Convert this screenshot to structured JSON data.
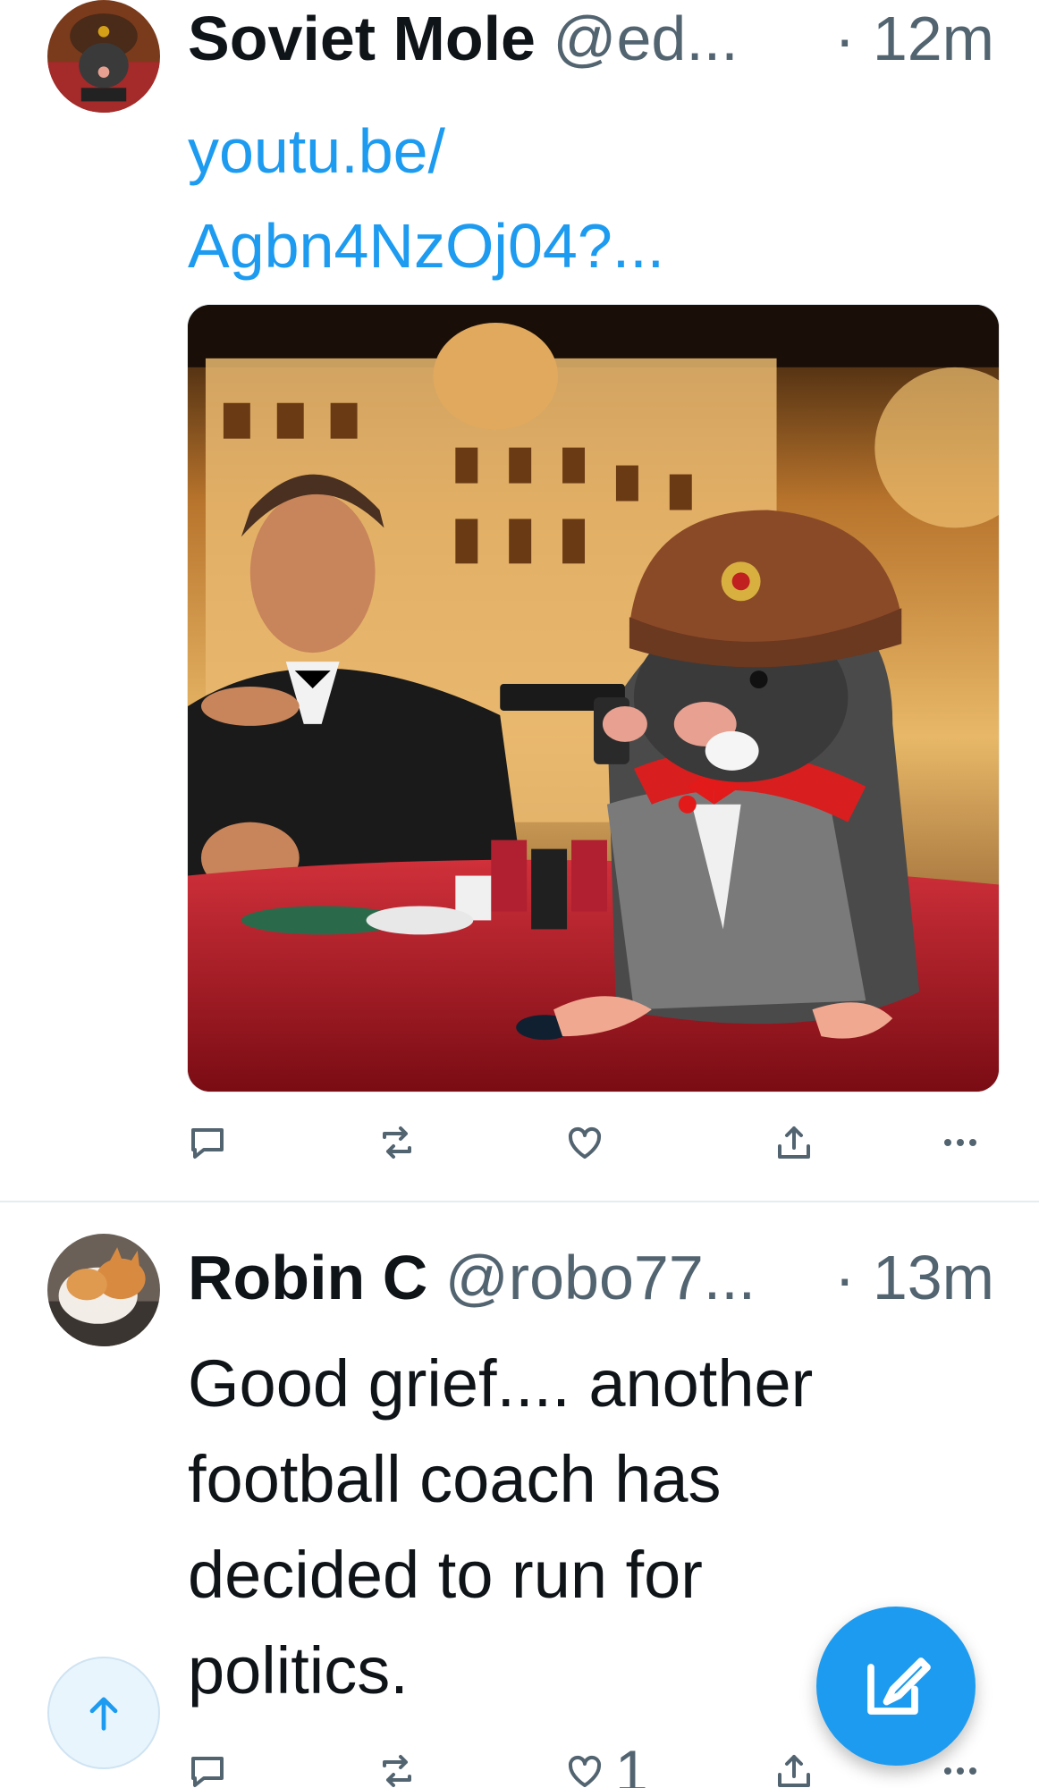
{
  "feed": {
    "tweets": [
      {
        "display_name": "Soviet Mole",
        "handle": "@ed...",
        "time": "· 12m",
        "link_lines": [
          "youtu.be/",
          "Agbn4NzOj04?..."
        ],
        "media": {
          "alt": "Illustration of a mole in a Soviet ushanka hat and tuxedo holding a pistol at a casino table beside a man in a tuxedo"
        },
        "actions": {
          "reply_count": "",
          "retweet_count": "",
          "like_count": "",
          "more_label": "···"
        }
      },
      {
        "display_name": "Robin C",
        "handle": "@robo77...",
        "time": "· 13m",
        "text_lines": [
          "Good grief.... another",
          "football coach has",
          "decided to run for",
          "politics."
        ],
        "actions": {
          "reply_count": "",
          "retweet_count": "",
          "like_count": "1",
          "more_label": "···"
        }
      }
    ]
  },
  "colors": {
    "accent": "#1d9bf0",
    "secondary_text": "#536471",
    "divider": "#e6ecf0"
  },
  "icons": {
    "reply": "reply-icon",
    "retweet": "retweet-icon",
    "like": "heart-icon",
    "share": "share-icon",
    "more": "more-icon",
    "scroll_top": "arrow-up-icon",
    "compose": "compose-icon"
  }
}
